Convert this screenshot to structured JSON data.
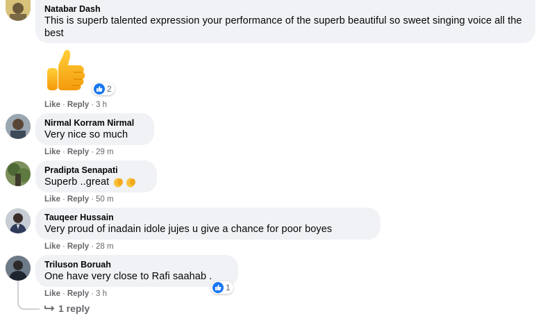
{
  "comments": [
    {
      "author": "Natabar Dash",
      "text": "This is superb talented expression your performance of the superb beautiful so sweet singing voice all the best",
      "like": "Like",
      "reply": "Reply",
      "time": "3 h",
      "sticker_reactions": "2"
    },
    {
      "author": "Nirmal Korram Nirmal",
      "text": "Very nice so much",
      "like": "Like",
      "reply": "Reply",
      "time": "29 m"
    },
    {
      "author": "Pradipta Senapati",
      "text": "Superb ..great",
      "like": "Like",
      "reply": "Reply",
      "time": "50 m"
    },
    {
      "author": "Tauqeer Hussain",
      "text": "Very proud of inadain idole jujes u give a chance for poor boyes",
      "like": "Like",
      "reply": "Reply",
      "time": "28 m"
    },
    {
      "author": "Triluson Boruah",
      "text": "One have very close to Rafi saahab .",
      "like": "Like",
      "reply": "Reply",
      "time": "3 h",
      "reactions": "1",
      "replies": "1 reply"
    }
  ],
  "icons": {
    "reaction": "like-thumb-icon",
    "sticker": "thumbs-up-sticker",
    "emoji": "clapping-hands-emoji",
    "reply_arrow": "reply-arrow-icon"
  },
  "colors": {
    "bubble": "#f0f2f5",
    "meta": "#65676b",
    "like_blue": "#1877f2"
  }
}
